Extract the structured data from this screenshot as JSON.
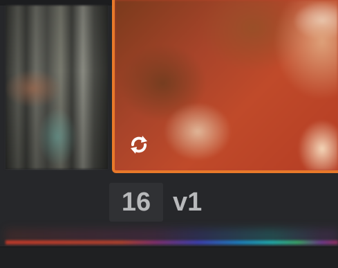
{
  "timeline": {
    "current_clip": {
      "number": "16",
      "version": "v1",
      "selected": true,
      "highlight_color": "#e8792a",
      "status_icon": "cache-refresh-icon"
    },
    "previous_clip": {
      "thumbnail": "clip-thumbnail"
    },
    "color_bar": {
      "colors": [
        "#b8392a",
        "#7c2f6a",
        "#3c3faa",
        "#1d79b7",
        "#20a3a4",
        "#3b9c64",
        "#6b3a86"
      ]
    }
  }
}
